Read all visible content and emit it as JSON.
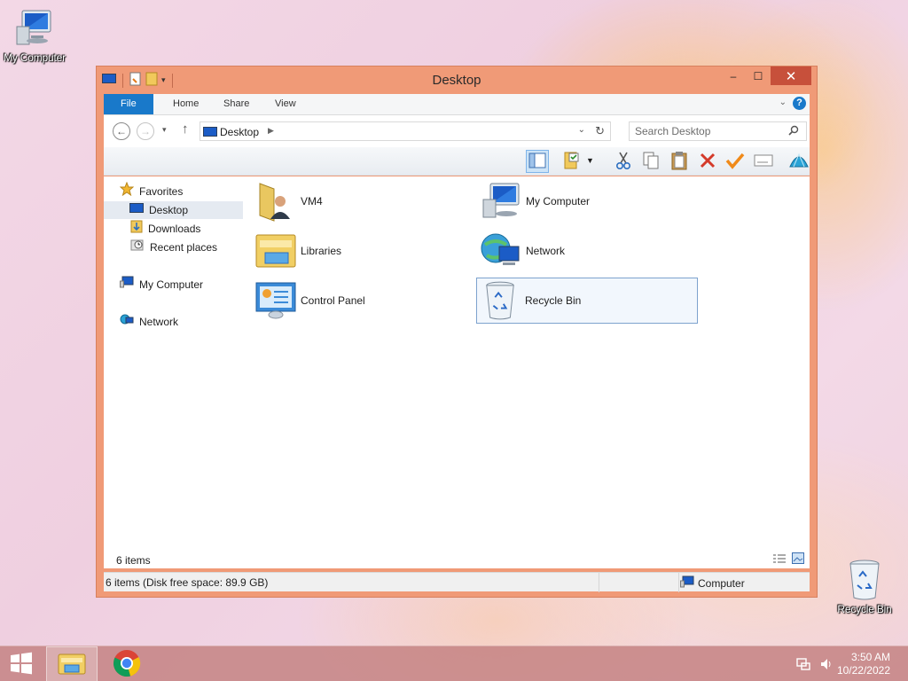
{
  "desktop": {
    "icons": [
      {
        "label": "My Computer",
        "icon": "computer-icon"
      },
      {
        "label": "Recycle Bin",
        "icon": "recycle-bin-icon"
      }
    ]
  },
  "window": {
    "title": "Desktop",
    "buttons": {
      "minimize": "–",
      "maximize": "☐",
      "close": "✕"
    },
    "ribbon_tabs": [
      "File",
      "Home",
      "Share",
      "View"
    ],
    "address": {
      "location": "Desktop",
      "icon": "computer-icon"
    },
    "search": {
      "placeholder": "Search Desktop"
    },
    "toolbar_icons": [
      "layout-pane-icon",
      "properties-icon",
      "cut-icon",
      "copy-icon",
      "paste-icon",
      "delete-icon",
      "checkmark-icon",
      "rename-icon",
      "shell-icon"
    ],
    "nav": {
      "favorites": "Favorites",
      "items": [
        "Desktop",
        "Downloads",
        "Recent places"
      ],
      "my_computer": "My Computer",
      "network": "Network"
    },
    "items": [
      {
        "name": "VM4",
        "icon": "user-folder-icon"
      },
      {
        "name": "My Computer",
        "icon": "computer-icon"
      },
      {
        "name": "Libraries",
        "icon": "libraries-icon"
      },
      {
        "name": "Network",
        "icon": "network-icon"
      },
      {
        "name": "Control Panel",
        "icon": "control-panel-icon"
      },
      {
        "name": "Recycle Bin",
        "icon": "recycle-bin-icon"
      }
    ],
    "item_count": "6 items",
    "status_left": "6 items (Disk free space: 89.9 GB)",
    "status_right": "Computer"
  },
  "taskbar": {
    "time": "3:50 AM",
    "date": "10/22/2022",
    "apps": [
      "start-icon",
      "file-explorer-icon",
      "chrome-icon"
    ],
    "tray": [
      "network-tray-icon",
      "volume-icon"
    ]
  }
}
